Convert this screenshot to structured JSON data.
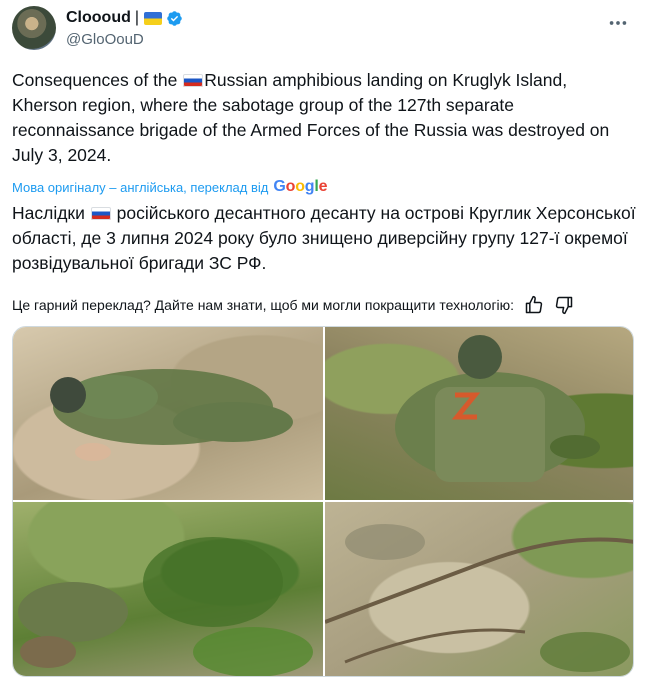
{
  "author": {
    "display_name": "Clooоud",
    "separator": "|",
    "handle": "@GloOouD"
  },
  "post": {
    "text_en_part1": "Consequences of the ",
    "text_en_part2": "Russian amphibious landing on Kruglyk Island, Kherson region, where the sabotage group of the 127th separate reconnaissance brigade of the Armed Forces of the Russia was destroyed on July 3, 2024.",
    "translation_note": "Мова оригіналу – англійська, переклад від",
    "google_letters": [
      "G",
      "o",
      "o",
      "g",
      "l",
      "e"
    ],
    "text_uk_part1": "Наслідки ",
    "text_uk_part2": "російського десантного десанту на острові Круглик Херсонської області, де 3 липня 2024 року було знищено диверсійну групу 127-ї окремої розвідувальної бригади ЗС РФ.",
    "feedback_prompt": "Це гарний переклад? Дайте нам знати, щоб ми могли покращити технологію:"
  },
  "icons": {
    "verified": "verified-badge-icon",
    "more": "more-options-icon",
    "thumbs_up": "thumbs-up-icon",
    "thumbs_down": "thumbs-down-icon",
    "flag_ua": "ukraine-flag-icon",
    "flag_ru": "russia-flag-icon"
  },
  "colors": {
    "link_blue": "#1d9bf0",
    "text": "#0f1419",
    "muted": "#536471"
  }
}
